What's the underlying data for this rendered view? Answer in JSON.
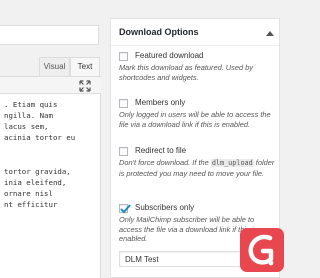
{
  "editor": {
    "tabs": {
      "visual": "Visual",
      "text": "Text"
    },
    "icons": {
      "expand": "expand-icon"
    },
    "lines": [
      ". Etiam quis",
      "ngilla. Nam",
      "lacus sem,",
      "acinia tortor eu",
      "",
      "",
      " tortor gravida,",
      "inia eleifend,",
      "ornare nisl",
      "nt efficitur"
    ]
  },
  "metabox": {
    "title": "Download Options",
    "icons": {
      "collapse": "caret-up-icon"
    },
    "options": [
      {
        "label": "Featured download",
        "checked": false,
        "desc": "Mark this download as featured. Used by shortcodes and widgets."
      },
      {
        "label": "Members only",
        "checked": false,
        "desc": "Only logged in users will be able to access the file via a download link if this is enabled."
      },
      {
        "label": "Redirect to file",
        "checked": false,
        "desc_before": "Don't force download. If the",
        "desc_code": "dlm_upload",
        "desc_after": "folder is protected you may need to move your file."
      },
      {
        "label": "Subscribers only",
        "checked": true,
        "desc": "Only MailChimp subscriber will be able to access the file via a download link if this is enabled."
      }
    ],
    "select": {
      "value": "DLM Test"
    }
  },
  "colors": {
    "accent": "#1e8cbe",
    "logo": "#e8474f"
  }
}
